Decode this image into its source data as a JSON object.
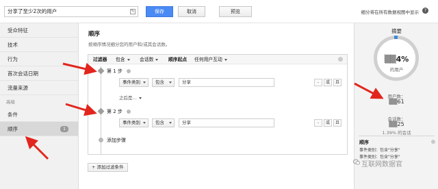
{
  "topbar": {
    "segment_name": "分享了至少2次的用户",
    "save_label": "保存",
    "cancel_label": "取消",
    "preview_label": "预览",
    "note": "细分将在所有数据视图中显示"
  },
  "sidebar": {
    "items": [
      {
        "label": "受众特征"
      },
      {
        "label": "技术"
      },
      {
        "label": "行为"
      },
      {
        "label": "首次会话日期"
      },
      {
        "label": "流量来源"
      }
    ],
    "section_label": "高级",
    "advanced_items": [
      {
        "label": "条件"
      },
      {
        "label": "顺序",
        "badge": "1"
      }
    ]
  },
  "main": {
    "title": "顺序",
    "description": "按顺序情况细分您的用户和/或其会话数。",
    "filter_bar": {
      "filter_label": "过滤器",
      "include_label": "包含",
      "session_label": "会话数",
      "sequence_start_label": "顺序起点",
      "any_interaction_label": "任何用户互动"
    },
    "step1": {
      "label": "第 1 步",
      "event_category": "事件类别",
      "op": "包含",
      "value": "分享",
      "minus": "-",
      "or": "或",
      "and": "且"
    },
    "then_label": "之后是…",
    "step2": {
      "label": "第 2 步",
      "event_category": "事件类别",
      "op": "包含",
      "value": "分享",
      "minus": "-",
      "or": "或",
      "and": "且"
    },
    "add_step_label": "添加步骤",
    "add_condition_label": "+ 添加过滤条件"
  },
  "summary": {
    "title": "摘要",
    "percent": "▒▒4%",
    "percent_sub": "的用户",
    "users_label": "用户数：",
    "users_value": "▒▒61",
    "sessions_label": "会话数：",
    "sessions_value": "▒▒25",
    "sessions_sub": "1.39% 的会话",
    "section_title": "顺序",
    "line1": "事件类别：包含\"分享\"",
    "line2": "事件类别：包含\"分享\""
  },
  "watermark": "互联网数据官",
  "colors": {
    "primary_button": "#4a8af4",
    "arrow_red": "#e2261d",
    "ring_accent": "#3f88d9"
  }
}
